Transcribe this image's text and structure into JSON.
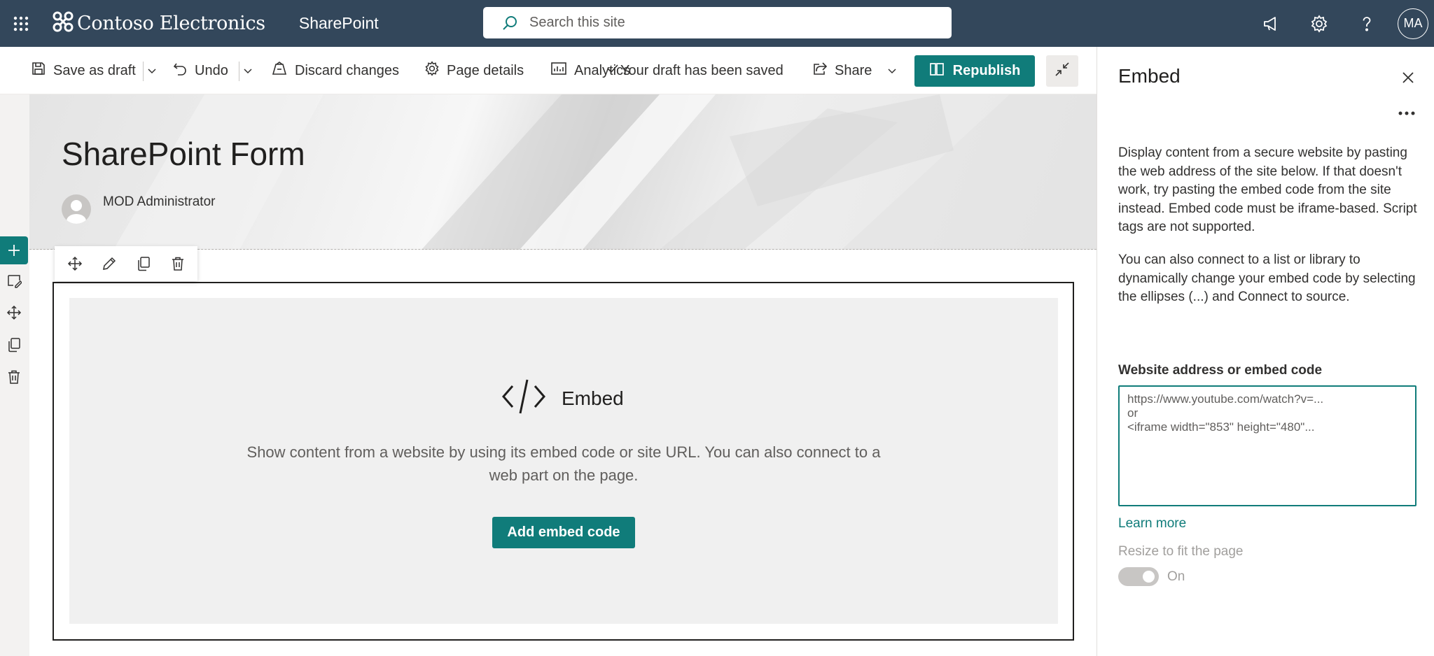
{
  "suite": {
    "brand": "Contoso Electronics",
    "app": "SharePoint",
    "search_placeholder": "Search this site",
    "avatar_initials": "MA",
    "icons": [
      "waffle-icon",
      "contoso-logo-icon",
      "search-icon",
      "megaphone-icon",
      "gear-icon",
      "help-icon"
    ]
  },
  "commandbar": {
    "save_draft": "Save as draft",
    "undo": "Undo",
    "discard": "Discard changes",
    "page_details": "Page details",
    "analytics": "Analytics",
    "draft_status": "Your draft has been saved",
    "share": "Share",
    "republish": "Republish"
  },
  "page": {
    "title": "SharePoint Form",
    "author": "MOD Administrator"
  },
  "webpart": {
    "title": "Embed",
    "description": "Show content from a website by using its embed code or site URL. You can also connect to a web part on the page.",
    "button": "Add embed code"
  },
  "pane": {
    "title": "Embed",
    "para1": "Display content from a secure website by pasting the web address of the site below. If that doesn't work, try pasting the embed code from the site instead. Embed code must be iframe-based. Script tags are not supported.",
    "para2": "You can also connect to a list or library to dynamically change your embed code by selecting the ellipses (...) and Connect to source.",
    "field_label": "Website address or embed code",
    "field_placeholder": "https://www.youtube.com/watch?v=...\nor\n<iframe width=\"853\" height=\"480\"...",
    "learn_more": "Learn more",
    "resize_label": "Resize to fit the page",
    "toggle_state": "On",
    "toggle_on": true
  },
  "colors": {
    "suite_bar": "#33475b",
    "accent": "#107c7a"
  }
}
